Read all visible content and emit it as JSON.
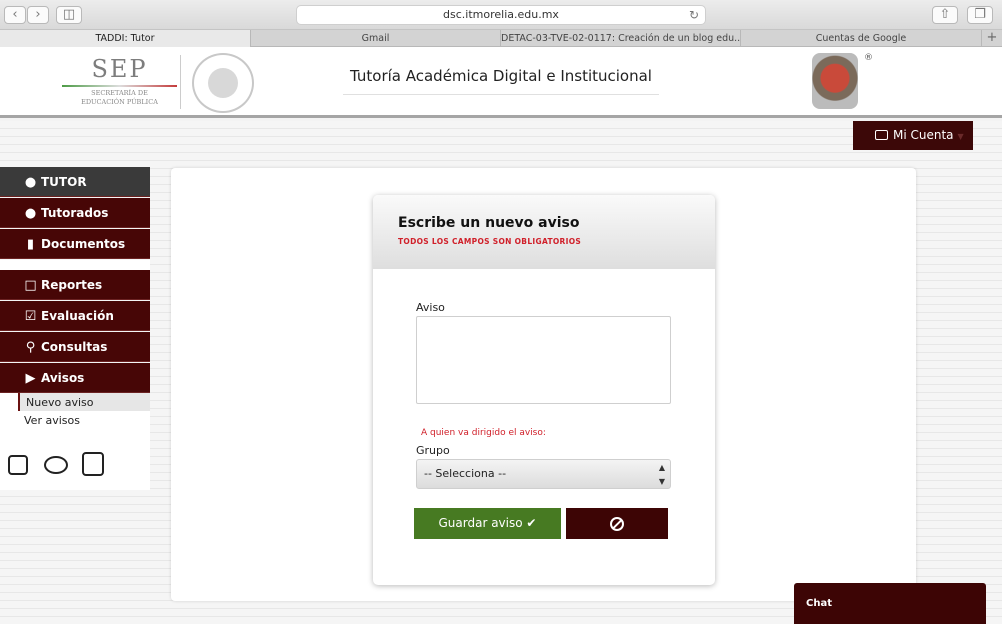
{
  "browser": {
    "url": "dsc.itmorelia.edu.mx",
    "tabs": [
      {
        "label": "TADDI: Tutor"
      },
      {
        "label": "Gmail"
      },
      {
        "label": "DETAC-03-TVE-02-0117: Creación de un blog edu..."
      },
      {
        "label": "Cuentas de Google"
      }
    ]
  },
  "header": {
    "sep_name": "SEP",
    "sep_line1": "SECRETARÍA DE",
    "sep_line2": "EDUCACIÓN PÚBLICA",
    "title": "Tutoría Académica Digital e Institucional",
    "reg_mark": "®"
  },
  "account": {
    "label": "Mi Cuenta"
  },
  "sidebar": {
    "items": [
      {
        "label": "TUTOR",
        "icon": "user-icon"
      },
      {
        "label": "Tutorados",
        "icon": "users-icon"
      },
      {
        "label": "Documentos",
        "icon": "document-icon"
      },
      {
        "label": "Reportes",
        "icon": "folder-icon"
      },
      {
        "label": "Evaluación",
        "icon": "checkbox-icon"
      },
      {
        "label": "Consultas",
        "icon": "search-icon"
      },
      {
        "label": "Avisos",
        "icon": "volume-icon"
      }
    ],
    "sub_items": [
      {
        "label": "Nuevo aviso"
      },
      {
        "label": "Ver avisos"
      }
    ]
  },
  "form": {
    "title": "Escribe un nuevo aviso",
    "subtitle": "TODOS LOS CAMPOS SON OBLIGATORIOS",
    "aviso_label": "Aviso",
    "aviso_value": "",
    "target_hint": "A quien va dirigido el aviso:",
    "grupo_label": "Grupo",
    "grupo_selected": "-- Selecciona --",
    "save_label": "Guardar aviso"
  },
  "chat": {
    "label": "Chat"
  },
  "colors": {
    "maroon": "#470606",
    "green": "#477a22",
    "alert_red": "#d0202a"
  }
}
